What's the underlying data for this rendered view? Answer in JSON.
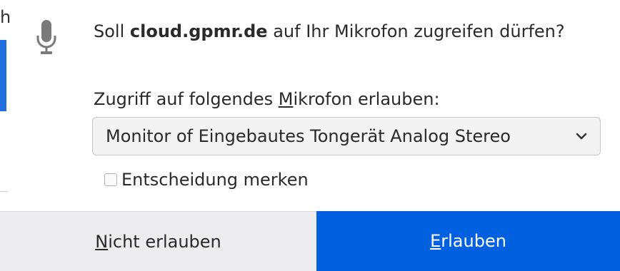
{
  "edge": {
    "glyph": "h"
  },
  "prompt": {
    "prefix": "Soll ",
    "host": "cloud.gpmr.de",
    "suffix": " auf Ihr Mikrofon zugreifen dürfen?"
  },
  "device_select": {
    "label_before": "Zugriff auf folgendes ",
    "label_access_key": "M",
    "label_after": "ikrofon erlauben:",
    "selected": "Monitor of Eingebautes Tongerät Analog Stereo"
  },
  "remember": {
    "label": "Entscheidung merken",
    "checked": false
  },
  "buttons": {
    "deny_access_key": "N",
    "deny_rest": "icht erlauben",
    "allow_access_key": "E",
    "allow_rest": "rlauben"
  },
  "colors": {
    "allow_button": "#0060df",
    "deny_button": "#ededf0",
    "select_background": "#f3f3f3"
  },
  "icons": {
    "prompt_icon": "microphone-icon",
    "dropdown_icon": "chevron-down-icon"
  }
}
